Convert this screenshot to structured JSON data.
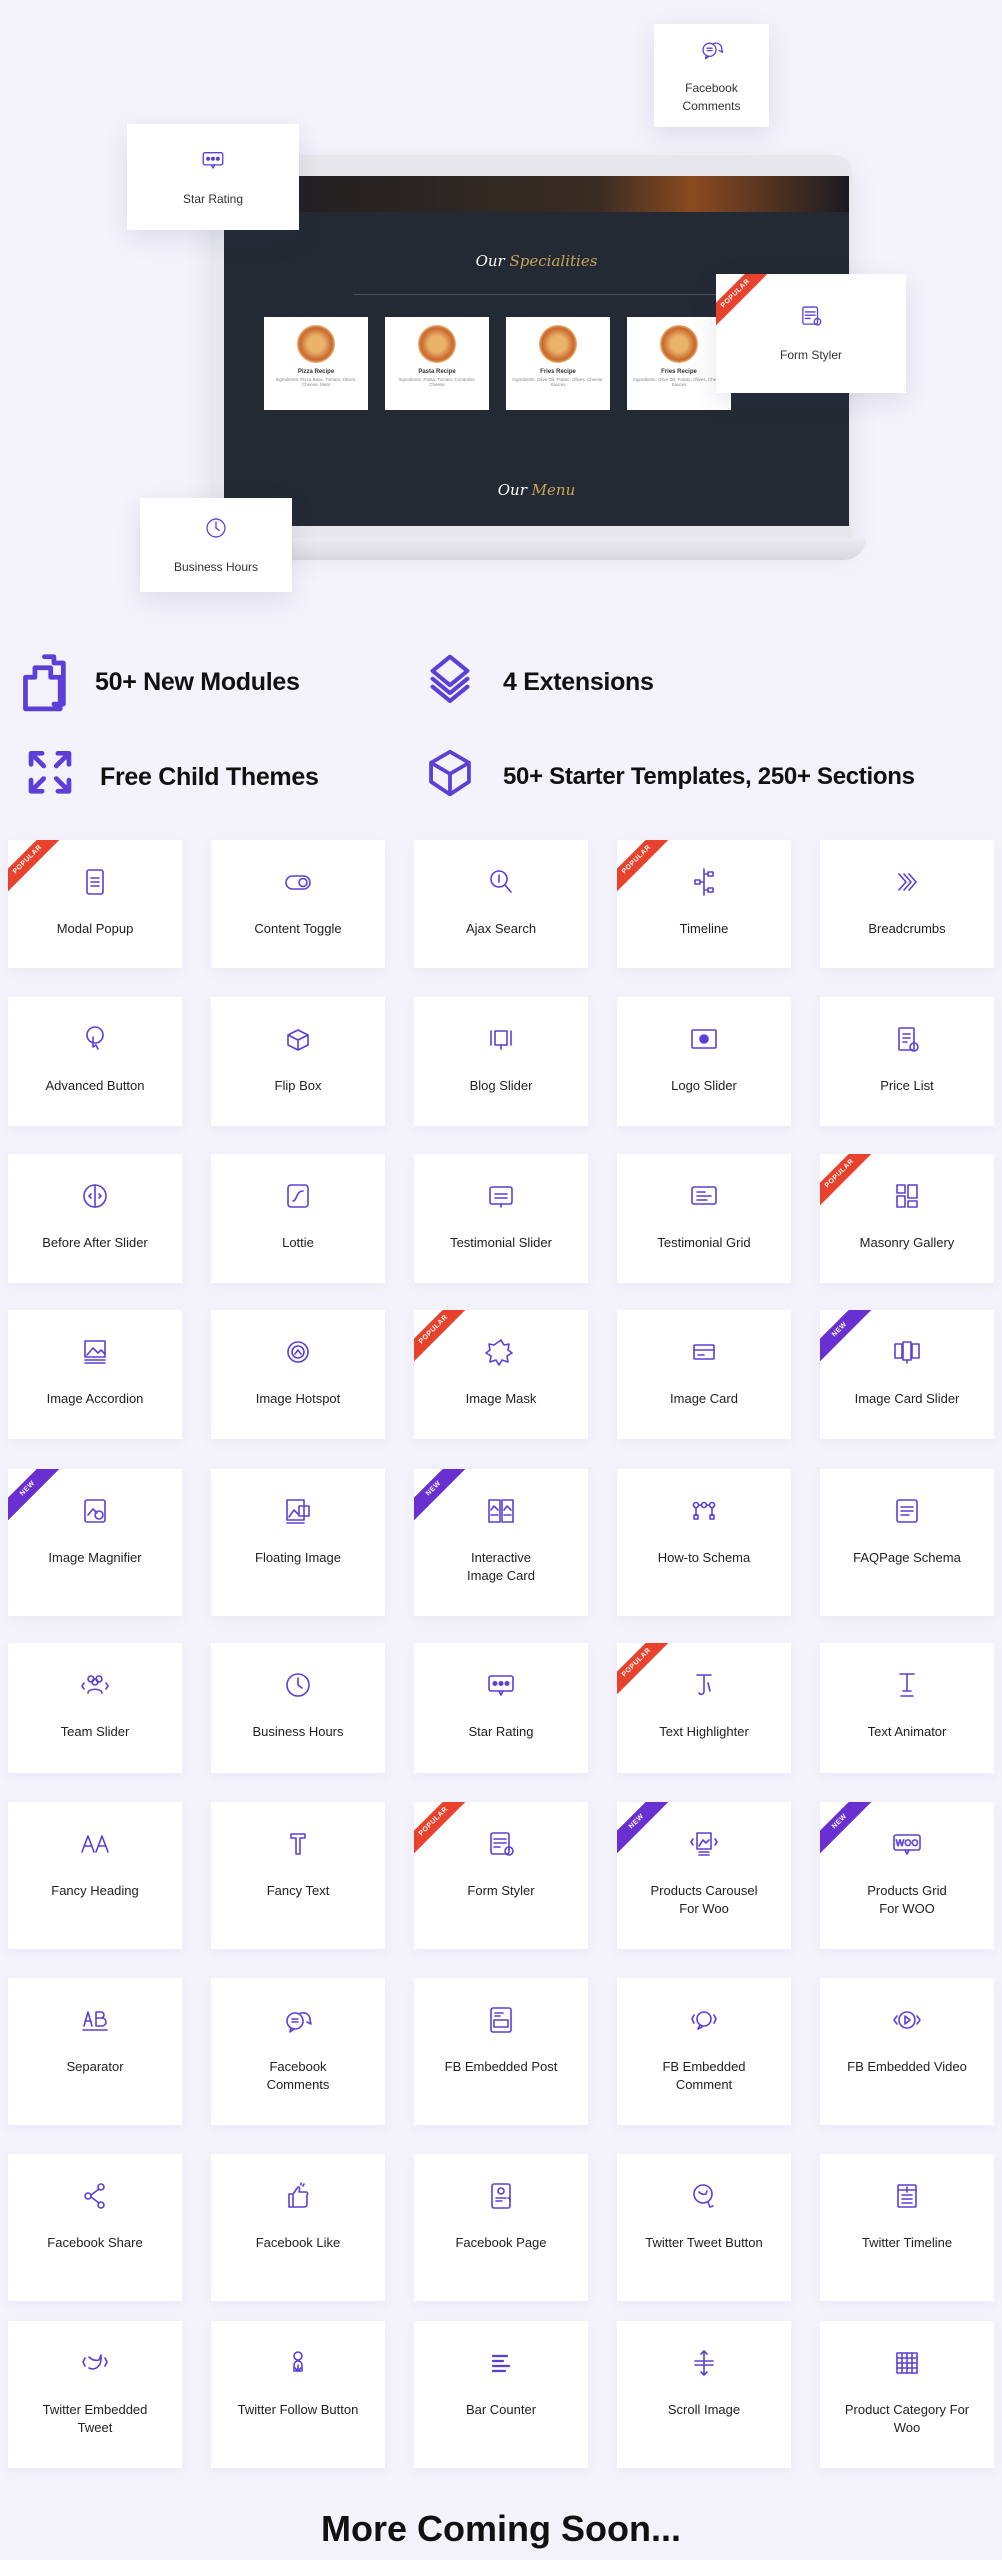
{
  "colors": {
    "accent": "#5b3fd6",
    "popular": "#e8412c",
    "new": "#6a2fd1",
    "background": "#f4f3fb"
  },
  "hero": {
    "floating_cards": [
      {
        "label": "Facebook\nComments",
        "icon": "chat-bubbles-icon"
      },
      {
        "label": "Star Rating",
        "icon": "rating-bubble-icon"
      },
      {
        "label": "Form Styler",
        "icon": "form-icon",
        "badge": "POPULAR"
      },
      {
        "label": "Business Hours",
        "icon": "clock-icon"
      }
    ],
    "screen": {
      "heading1": {
        "a": "Our",
        "b": "Specialities"
      },
      "heading2": {
        "a": "Our",
        "b": "Menu"
      },
      "foods": [
        {
          "title": "Pizza Recipe",
          "desc": "Ingredients: Pizza Base, Tomato, Olives, Cheese, Meat"
        },
        {
          "title": "Pasta Recipe",
          "desc": "Ingredients: Pasta, Tomato, Coriander, Cheese"
        },
        {
          "title": "Fries Recipe",
          "desc": "Ingredients: Olive Oil, Potato, Olives, Cheese, Sauces"
        },
        {
          "title": "Fries Recipe",
          "desc": "Ingredients: Olive Oil, Potato, Olives, Cheese, Sauces"
        }
      ]
    }
  },
  "features": [
    {
      "label": "50+ New Modules",
      "icon": "folders-icon"
    },
    {
      "label": "4 Extensions",
      "icon": "layers-icon"
    },
    {
      "label": "Free Child Themes",
      "icon": "expand-arrows-icon"
    },
    {
      "label": "50+ Starter Templates, 250+ Sections",
      "icon": "box-icon"
    }
  ],
  "modules": [
    {
      "label": "Modal Popup",
      "icon": "modal-icon",
      "badge": "POPULAR"
    },
    {
      "label": "Content Toggle",
      "icon": "toggle-icon"
    },
    {
      "label": "Ajax Search",
      "icon": "search-icon"
    },
    {
      "label": "Timeline",
      "icon": "timeline-icon",
      "badge": "POPULAR"
    },
    {
      "label": "Breadcrumbs",
      "icon": "chevrons-icon"
    },
    {
      "label": "Advanced Button",
      "icon": "button-click-icon"
    },
    {
      "label": "Flip Box",
      "icon": "flip-box-icon"
    },
    {
      "label": "Blog Slider",
      "icon": "blog-slider-icon"
    },
    {
      "label": "Logo Slider",
      "icon": "logo-slider-icon"
    },
    {
      "label": "Price List",
      "icon": "price-list-icon"
    },
    {
      "label": "Before After Slider",
      "icon": "before-after-icon"
    },
    {
      "label": "Lottie",
      "icon": "lottie-icon"
    },
    {
      "label": "Testimonial Slider",
      "icon": "testimonial-icon"
    },
    {
      "label": "Testimonial Grid",
      "icon": "testimonial-grid-icon"
    },
    {
      "label": "Masonry Gallery",
      "icon": "masonry-icon",
      "badge": "POPULAR"
    },
    {
      "label": "Image Accordion",
      "icon": "image-icon"
    },
    {
      "label": "Image Hotspot",
      "icon": "hotspot-icon"
    },
    {
      "label": "Image Mask",
      "icon": "mask-icon",
      "badge": "POPULAR"
    },
    {
      "label": "Image Card",
      "icon": "card-icon"
    },
    {
      "label": "Image Card Slider",
      "icon": "card-slider-icon",
      "badge": "NEW"
    },
    {
      "label": "Image Magnifier",
      "icon": "magnifier-image-icon",
      "badge": "NEW"
    },
    {
      "label": "Floating Image",
      "icon": "floating-image-icon"
    },
    {
      "label": "Interactive\nImage Card",
      "icon": "interactive-card-icon",
      "badge": "NEW"
    },
    {
      "label": "How-to Schema",
      "icon": "schema-icon"
    },
    {
      "label": "FAQPage Schema",
      "icon": "faq-icon"
    },
    {
      "label": "Team Slider",
      "icon": "team-icon"
    },
    {
      "label": "Business Hours",
      "icon": "clock-icon"
    },
    {
      "label": "Star Rating",
      "icon": "rating-bubble-icon"
    },
    {
      "label": "Text Highlighter",
      "icon": "text-highlight-icon",
      "badge": "POPULAR"
    },
    {
      "label": "Text Animator",
      "icon": "text-animator-icon"
    },
    {
      "label": "Fancy Heading",
      "icon": "fancy-heading-icon"
    },
    {
      "label": "Fancy Text",
      "icon": "fancy-text-icon"
    },
    {
      "label": "Form Styler",
      "icon": "form-icon",
      "badge": "POPULAR"
    },
    {
      "label": "Products Carousel\nFor Woo",
      "icon": "product-carousel-icon",
      "badge": "NEW"
    },
    {
      "label": "Products Grid\nFor WOO",
      "icon": "woo-icon",
      "badge": "NEW"
    },
    {
      "label": "Separator",
      "icon": "separator-icon"
    },
    {
      "label": "Facebook\nComments",
      "icon": "chat-bubbles-icon"
    },
    {
      "label": "FB Embedded Post",
      "icon": "embedded-post-icon"
    },
    {
      "label": "FB Embedded\nComment",
      "icon": "embedded-comment-icon"
    },
    {
      "label": "FB Embedded Video",
      "icon": "video-icon"
    },
    {
      "label": "Facebook Share",
      "icon": "share-icon"
    },
    {
      "label": "Facebook Like",
      "icon": "thumbs-up-icon"
    },
    {
      "label": "Facebook Page",
      "icon": "fb-page-icon"
    },
    {
      "label": "Twitter Tweet Button",
      "icon": "tweet-button-icon"
    },
    {
      "label": "Twitter Timeline",
      "icon": "twitter-timeline-icon"
    },
    {
      "label": "Twitter Embedded\nTweet",
      "icon": "twitter-embed-icon"
    },
    {
      "label": "Twitter Follow Button",
      "icon": "follow-icon"
    },
    {
      "label": "Bar Counter",
      "icon": "bar-counter-icon"
    },
    {
      "label": "Scroll Image",
      "icon": "scroll-icon"
    },
    {
      "label": "Product Category For\nWoo",
      "icon": "grid-icon"
    }
  ],
  "footer": {
    "more": "More Coming Soon..."
  }
}
